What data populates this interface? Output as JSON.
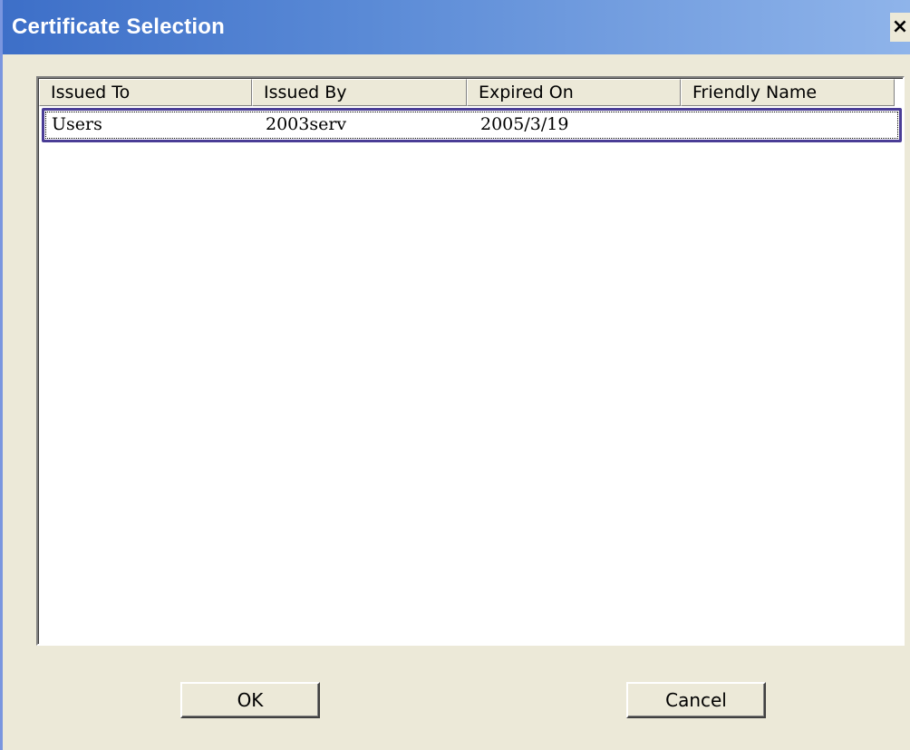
{
  "window": {
    "title": "Certificate Selection",
    "close_label": "×"
  },
  "list": {
    "columns": [
      "Issued To",
      "Issued By",
      "Expired On",
      "Friendly Name"
    ],
    "rows": [
      {
        "issued_to": "Users",
        "issued_by": "2003serv",
        "expired_on": "2005/3/19",
        "friendly_name": ""
      }
    ],
    "selected_row": 0
  },
  "buttons": {
    "ok_label": "OK",
    "cancel_label": "Cancel"
  },
  "colors": {
    "titlebar_start": "#3d6fc8",
    "titlebar_end": "#8fb4ea",
    "dialog_bg": "#ece9d8",
    "selection_border": "#4a3d96"
  }
}
